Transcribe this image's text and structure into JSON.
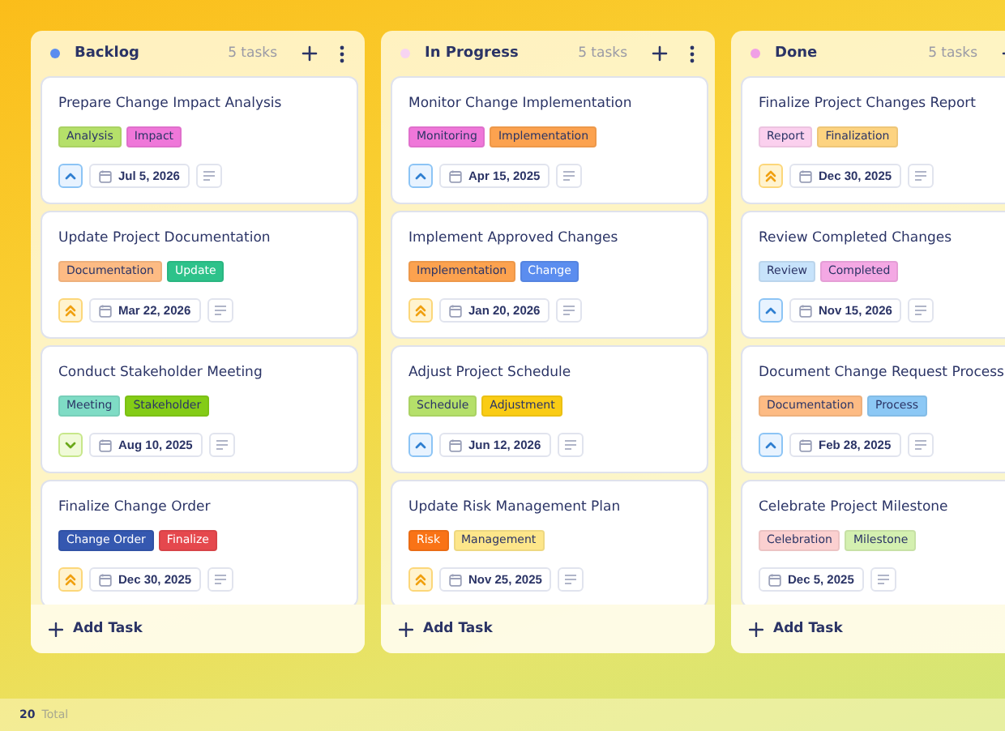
{
  "columns": [
    {
      "title": "Backlog",
      "color": "#5b8def",
      "count": "5 tasks",
      "add_label": "Add Task",
      "cards": [
        {
          "title": "Prepare Change Impact Analysis",
          "kind": "medium",
          "date": "Jul 5, 2026",
          "tags": [
            {
              "label": "Analysis",
              "color": "#b5e06a",
              "kind": "soft"
            },
            {
              "label": "Impact",
              "color": "#ef77d9",
              "kind": "soft"
            }
          ]
        },
        {
          "title": "Update Project Documentation",
          "kind": "high",
          "date": "Mar 22, 2026",
          "tags": [
            {
              "label": "Documentation",
              "color": "#fdbb84",
              "kind": "soft"
            },
            {
              "label": "Update",
              "color": "#2dc28a",
              "kind": "solid"
            }
          ]
        },
        {
          "title": "Conduct Stakeholder Meeting",
          "kind": "low",
          "date": "Aug 10, 2025",
          "tags": [
            {
              "label": "Meeting",
              "color": "#7fdcc5",
              "kind": "soft"
            },
            {
              "label": "Stakeholder",
              "color": "#84cc16",
              "kind": "soft"
            }
          ]
        },
        {
          "title": "Finalize Change Order",
          "kind": "high",
          "date": "Dec 30, 2025",
          "tags": [
            {
              "label": "Change Order",
              "color": "#3558b0",
              "kind": "solid"
            },
            {
              "label": "Finalize",
              "color": "#e5484d",
              "kind": "solid"
            }
          ]
        }
      ]
    },
    {
      "title": "In Progress",
      "color": "#f7d4f2",
      "count": "5 tasks",
      "add_label": "Add Task",
      "cards": [
        {
          "title": "Monitor Change Implementation",
          "kind": "medium",
          "date": "Apr 15, 2025",
          "tags": [
            {
              "label": "Monitoring",
              "color": "#ef77d9",
              "kind": "soft"
            },
            {
              "label": "Implementation",
              "color": "#fca24f",
              "kind": "soft"
            }
          ]
        },
        {
          "title": "Implement Approved Changes",
          "kind": "high",
          "date": "Jan 20, 2026",
          "tags": [
            {
              "label": "Implementation",
              "color": "#fca24f",
              "kind": "soft"
            },
            {
              "label": "Change",
              "color": "#5b8def",
              "kind": "solid"
            }
          ]
        },
        {
          "title": "Adjust Project Schedule",
          "kind": "medium",
          "date": "Jun 12, 2026",
          "tags": [
            {
              "label": "Schedule",
              "color": "#b5e06a",
              "kind": "soft"
            },
            {
              "label": "Adjustment",
              "color": "#facc15",
              "kind": "soft"
            }
          ]
        },
        {
          "title": "Update Risk Management Plan",
          "kind": "high",
          "date": "Nov 25, 2025",
          "tags": [
            {
              "label": "Risk",
              "color": "#f97316",
              "kind": "solid"
            },
            {
              "label": "Management",
              "color": "#fde68a",
              "kind": "soft"
            }
          ]
        }
      ]
    },
    {
      "title": "Done",
      "color": "#f0a0e6",
      "count": "5 tasks",
      "add_label": "Add Task",
      "cards": [
        {
          "title": "Finalize Project Changes Report",
          "kind": "high",
          "date": "Dec 30, 2025",
          "tags": [
            {
              "label": "Report",
              "color": "#fbd0ee",
              "kind": "soft"
            },
            {
              "label": "Finalization",
              "color": "#fdd380",
              "kind": "soft"
            }
          ]
        },
        {
          "title": "Review Completed Changes",
          "kind": "medium",
          "date": "Nov 15, 2026",
          "tags": [
            {
              "label": "Review",
              "color": "#c7e3fb",
              "kind": "soft"
            },
            {
              "label": "Completed",
              "color": "#f4a8e4",
              "kind": "soft"
            }
          ]
        },
        {
          "title": "Document Change Request Process",
          "kind": "medium",
          "date": "Feb 28, 2025",
          "tags": [
            {
              "label": "Documentation",
              "color": "#fdbb84",
              "kind": "soft"
            },
            {
              "label": "Process",
              "color": "#8cc8f5",
              "kind": "soft"
            }
          ]
        },
        {
          "title": "Celebrate Project Milestone",
          "kind": "plain",
          "date": "Dec 5, 2025",
          "tags": [
            {
              "label": "Celebration",
              "color": "#fbd0d0",
              "kind": "soft"
            },
            {
              "label": "Milestone",
              "color": "#d4f0b0",
              "kind": "soft"
            }
          ]
        }
      ]
    }
  ],
  "footer": {
    "count": "20",
    "label": "Total"
  }
}
